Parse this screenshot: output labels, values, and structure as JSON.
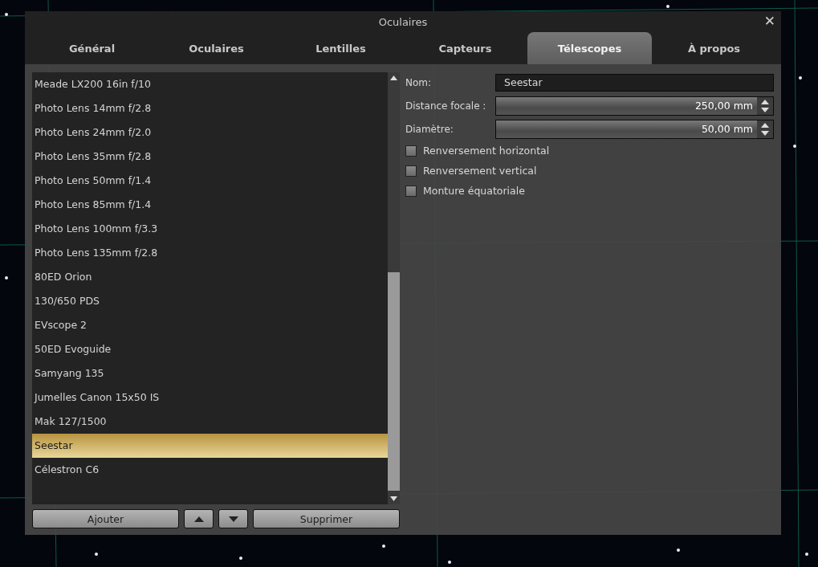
{
  "window": {
    "title": "Oculaires",
    "close": "✕"
  },
  "tabs": [
    {
      "label": "Général",
      "selected": false
    },
    {
      "label": "Oculaires",
      "selected": false
    },
    {
      "label": "Lentilles",
      "selected": false
    },
    {
      "label": "Capteurs",
      "selected": false
    },
    {
      "label": "Télescopes",
      "selected": true
    },
    {
      "label": "À propos",
      "selected": false
    }
  ],
  "telescopes": [
    {
      "name": "Meade  LX200 16in f/10",
      "selected": false
    },
    {
      "name": "Photo Lens 14mm f/2.8",
      "selected": false
    },
    {
      "name": "Photo Lens 24mm f/2.0",
      "selected": false
    },
    {
      "name": "Photo Lens 35mm f/2.8",
      "selected": false
    },
    {
      "name": "Photo Lens 50mm f/1.4",
      "selected": false
    },
    {
      "name": "Photo Lens 85mm f/1.4",
      "selected": false
    },
    {
      "name": "Photo Lens 100mm f/3.3",
      "selected": false
    },
    {
      "name": "Photo Lens 135mm f/2.8",
      "selected": false
    },
    {
      "name": "80ED Orion",
      "selected": false
    },
    {
      "name": "130/650 PDS",
      "selected": false
    },
    {
      "name": "EVscope 2",
      "selected": false
    },
    {
      "name": "50ED Evoguide",
      "selected": false
    },
    {
      "name": "Samyang 135",
      "selected": false
    },
    {
      "name": "Jumelles Canon 15x50 IS",
      "selected": false
    },
    {
      "name": "Mak 127/1500",
      "selected": false
    },
    {
      "name": "Seestar",
      "selected": true
    },
    {
      "name": "Célestron C6",
      "selected": false
    }
  ],
  "list_buttons": [
    {
      "kind": "text",
      "label": "Ajouter"
    },
    {
      "kind": "up"
    },
    {
      "kind": "down"
    },
    {
      "kind": "text",
      "label": "Supprimer"
    }
  ],
  "form": {
    "name": {
      "label": "Nom:",
      "value": "Seestar"
    },
    "spins": [
      {
        "label": "Distance focale :",
        "value": "250,00 mm"
      },
      {
        "label": "Diamètre:",
        "value": "50,00 mm"
      }
    ],
    "checks": [
      {
        "label": "Renversement horizontal",
        "checked": false
      },
      {
        "label": "Renversement vertical",
        "checked": false
      },
      {
        "label": "Monture équatoriale",
        "checked": false
      }
    ]
  }
}
